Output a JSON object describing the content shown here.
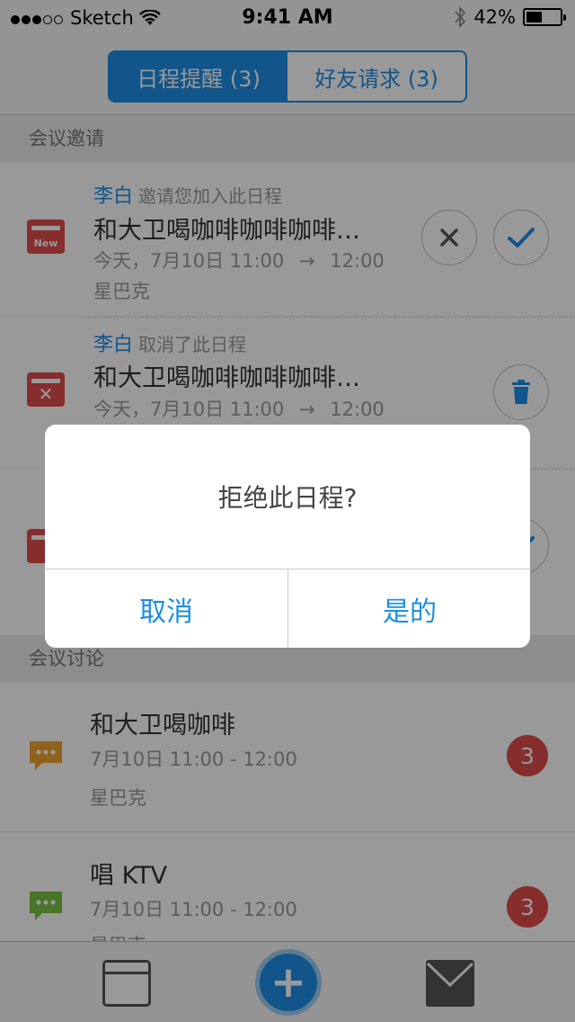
{
  "status_bar": {
    "carrier": "Sketch",
    "time": "9:41 AM",
    "battery": "42%",
    "battery_level": 0.42
  },
  "segmented": {
    "tabs": [
      {
        "label": "日程提醒 (3)",
        "active": true
      },
      {
        "label": "好友请求 (3)",
        "active": false
      }
    ]
  },
  "sections": {
    "invites": "会议邀请",
    "discussions": "会议讨论"
  },
  "invites": [
    {
      "icon": "calendar-new-icon",
      "icon_label": "New",
      "name": "李白",
      "action": "邀请您加入此日程",
      "title": "和大卫喝咖啡咖啡咖啡…",
      "date": "今天，7月10日 11:00",
      "arrow": "→",
      "end": "12:00",
      "place": "星巴克"
    },
    {
      "icon": "calendar-cancel-icon",
      "name": "李白",
      "action": "取消了此日程",
      "title": "和大卫喝咖啡咖啡咖啡…",
      "date": "今天，7月10日 11:00",
      "arrow": "→",
      "end": "12:00"
    }
  ],
  "discussions": [
    {
      "icon": "chat-orange-icon",
      "title": "和大卫喝咖啡",
      "time": "7月10日 11:00 - 12:00",
      "place": "星巴克",
      "count": "3"
    },
    {
      "icon": "chat-green-icon",
      "title": "唱 KTV",
      "time": "7月10日 11:00 - 12:00",
      "place": "星巴克",
      "count": "3"
    }
  ],
  "dialog": {
    "message": "拒绝此日程?",
    "cancel": "取消",
    "confirm": "是的"
  },
  "tab_bar": {
    "items": [
      "calendar-tab-icon",
      "add-icon",
      "mail-tab-icon"
    ],
    "plus": "+"
  },
  "colors": {
    "accent": "#1d8ee6",
    "danger": "#e04b4b",
    "chat_orange": "#f0a330",
    "chat_green": "#7cc142"
  }
}
